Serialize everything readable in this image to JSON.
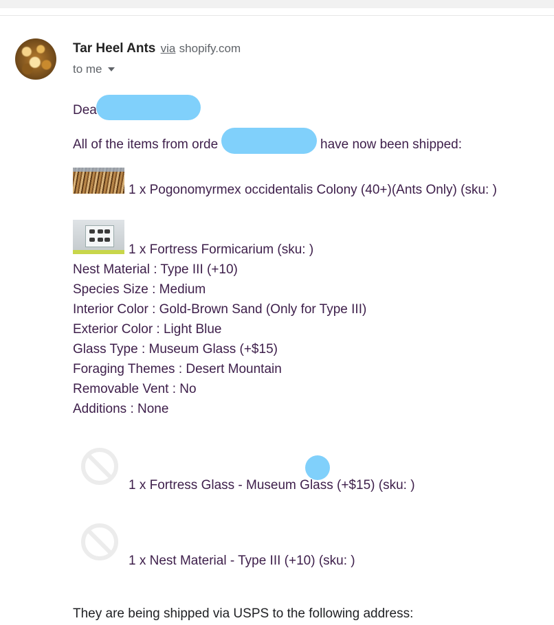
{
  "header": {
    "sender_name": "Tar Heel Ants",
    "via_label": "via",
    "via_domain": "shopify.com",
    "recipient_label": "to me"
  },
  "body": {
    "greeting": "Dea",
    "intro_prefix": "All of the items from orde",
    "intro_suffix": "have now been shipped:",
    "items": [
      {
        "text": "1 x Pogonomyrmex occidentalis Colony (40+)(Ants Only) (sku: )",
        "image": "ant-colony-thumbnail"
      },
      {
        "text": "1 x Fortress Formicarium (sku: )",
        "image": "formicarium-thumbnail"
      },
      {
        "text": "1 x Fortress Glass - Museum Glass (+$15) (sku: )",
        "image": "no-image-icon"
      },
      {
        "text": "1 x Nest Material - Type III (+10) (sku: )",
        "image": "no-image-icon"
      }
    ],
    "options": [
      "Nest Material : Type III (+10)",
      "Species Size : Medium",
      "Interior Color : Gold-Brown Sand (Only for Type III)",
      "Exterior Color : Light Blue",
      "Glass Type : Museum Glass (+$15)",
      "Foraging Themes : Desert Mountain",
      "Removable Vent : No",
      "Additions : None"
    ],
    "shipping": "They are being shipped via USPS to the following address:"
  },
  "colors": {
    "body_text": "#3d1e4a",
    "redaction": "#80d0fb",
    "secondary_text": "#5f6368"
  }
}
